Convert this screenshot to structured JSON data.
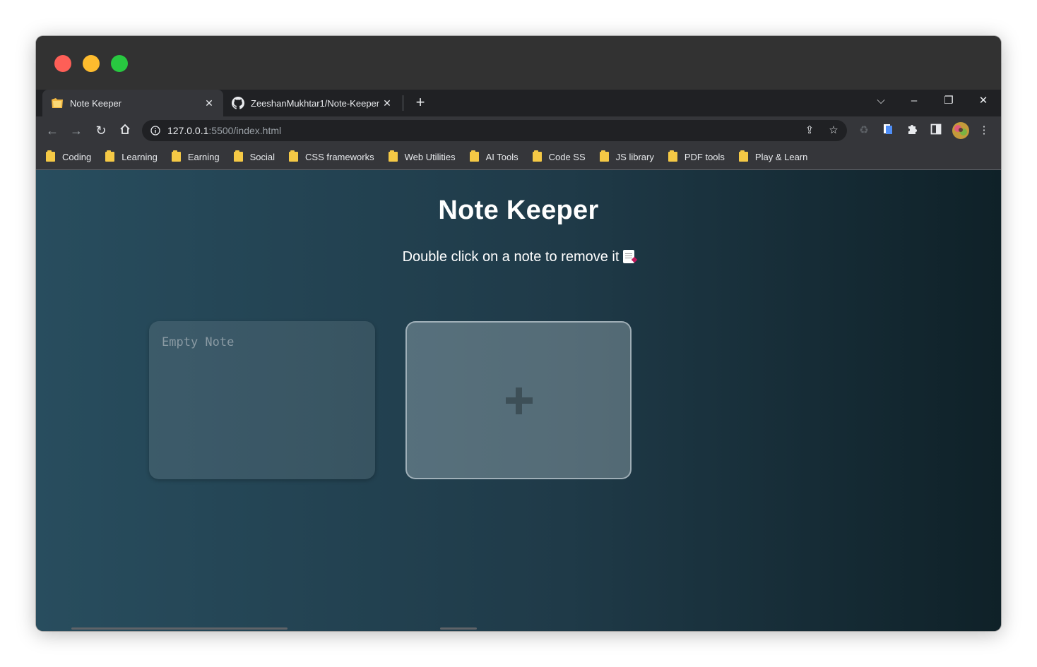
{
  "browser": {
    "tabs": [
      {
        "title": "Note Keeper",
        "favicon": "note-keeper-favicon",
        "active": true
      },
      {
        "title": "ZeeshanMukhtar1/Note-Keeper",
        "favicon": "github-icon",
        "active": false
      }
    ],
    "url_host": "127.0.0.1",
    "url_path": ":5500/index.html",
    "bookmarks": [
      "Coding",
      "Learning",
      "Earning",
      "Social",
      "CSS frameworks",
      "Web Utilities",
      "AI Tools",
      "Code SS",
      "JS library",
      "PDF tools",
      "Play & Learn"
    ]
  },
  "page": {
    "title": "Note Keeper",
    "subtitle": "Double click on a note to remove it",
    "subtitle_icon": "memo-icon",
    "note_placeholder": "Empty Note",
    "add_button_icon": "plus-icon"
  },
  "colors": {
    "titlebar": "#323232",
    "toolbar": "#35363a",
    "bg_start": "#284d5e",
    "bg_end": "#0f2128",
    "bookmark_folder": "#f5c945"
  }
}
